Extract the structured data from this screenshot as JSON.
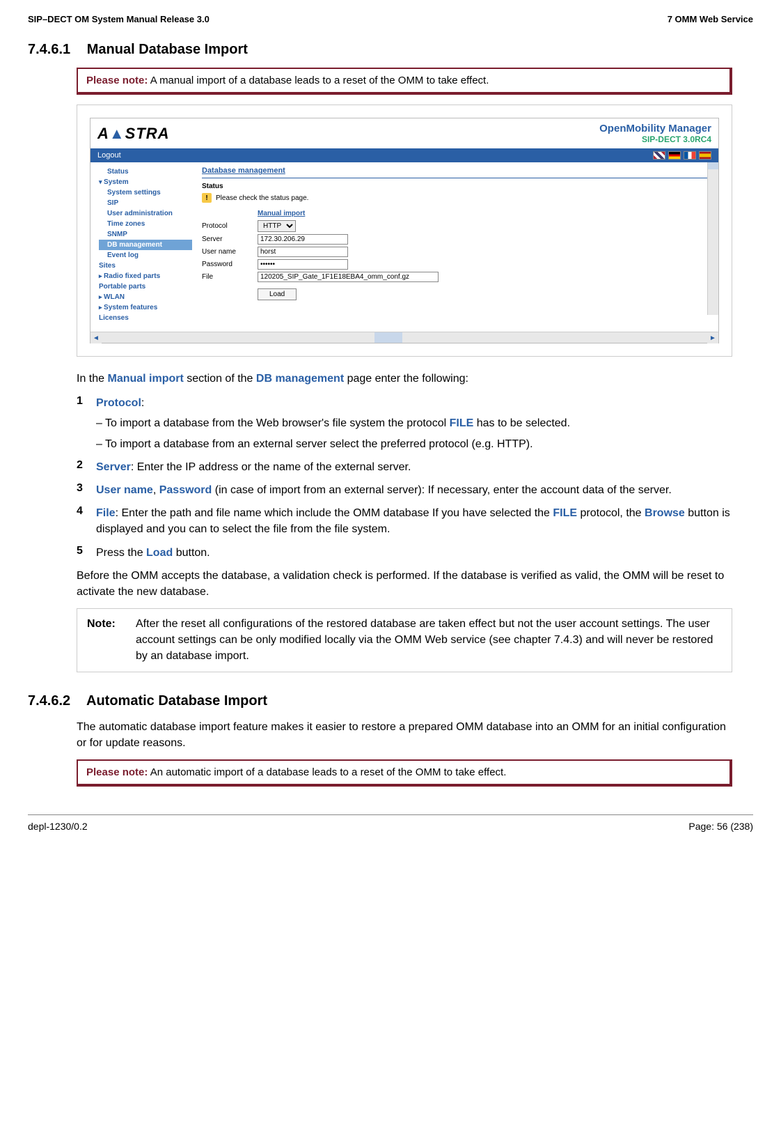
{
  "header": {
    "left": "SIP–DECT OM System Manual Release 3.0",
    "right": "7 OMM Web Service"
  },
  "section1": {
    "number": "7.4.6.1",
    "title": "Manual Database Import"
  },
  "please_note1": {
    "label": "Please note:",
    "text": "A manual import of a database leads to a reset of the OMM to take effect."
  },
  "screenshot": {
    "logo_a": "A",
    "logo_rest": "STRA",
    "title1": "OpenMobility Manager",
    "title2": "SIP-DECT 3.0RC4",
    "logout": "Logout",
    "nav": {
      "status": "Status",
      "system": "System",
      "system_settings": "System settings",
      "sip": "SIP",
      "user_admin": "User administration",
      "time_zones": "Time zones",
      "snmp": "SNMP",
      "db_mgmt": "DB management",
      "event_log": "Event log",
      "sites": "Sites",
      "radio": "Radio fixed parts",
      "portable": "Portable parts",
      "wlan": "WLAN",
      "features": "System features",
      "licenses": "Licenses"
    },
    "main": {
      "title": "Database management",
      "status_label": "Status",
      "status_msg": "Please check the status page.",
      "section": "Manual import",
      "protocol_label": "Protocol",
      "protocol_value": "HTTP",
      "server_label": "Server",
      "server_value": "172.30.206.29",
      "user_label": "User name",
      "user_value": "horst",
      "pw_label": "Password",
      "pw_value": "••••••",
      "file_label": "File",
      "file_value": "120205_SIP_Gate_1F1E18EBA4_omm_conf.gz",
      "load": "Load"
    }
  },
  "intro": {
    "p1a": "In the ",
    "kw1": "Manual import",
    "p1b": " section of the ",
    "kw2": "DB management",
    "p1c": " page enter the following:"
  },
  "steps": {
    "s1": {
      "num": "1",
      "kw": "Protocol",
      "colon": ":",
      "sub1a": "– To import a database from the Web browser's file system the protocol ",
      "sub1kw": "FILE",
      "sub1b": " has to be selected.",
      "sub2": "– To import a database from an external server select the preferred protocol (e.g. HTTP)."
    },
    "s2": {
      "num": "2",
      "kw": "Server",
      "text": ": Enter the IP address or the name of the external server."
    },
    "s3": {
      "num": "3",
      "kw1": "User name",
      "sep": ", ",
      "kw2": "Password",
      "text": " (in case of import from an external server): If necessary, enter the account data of the server."
    },
    "s4": {
      "num": "4",
      "kw1": "File",
      "t1": ": Enter the path and file name which include the OMM database If you have selected the ",
      "kw2": "FILE",
      "t2": " protocol, the ",
      "kw3": "Browse",
      "t3": " button is displayed and you can to select the file from the file system."
    },
    "s5": {
      "num": "5",
      "t1": "Press the ",
      "kw": "Load",
      "t2": " button."
    }
  },
  "after": "Before the OMM accepts the database, a validation check is performed. If the database is verified as valid, the OMM will be reset to activate the new database.",
  "note2": {
    "label": "Note:",
    "text": "After the reset all configurations of the restored database are taken effect but not the user account settings. The user account settings can be only modified locally via the OMM Web service (see chapter 7.4.3) and will never be restored by an database import."
  },
  "section2": {
    "number": "7.4.6.2",
    "title": "Automatic Database Import"
  },
  "auto_intro": "The automatic database import feature makes it easier to restore a prepared OMM database into an OMM for an initial configuration or for update reasons.",
  "please_note2": {
    "label": "Please note:",
    "text": "An automatic import of a database leads to a reset of the OMM to take effect."
  },
  "footer": {
    "left": "depl-1230/0.2",
    "right": "Page: 56 (238)"
  }
}
